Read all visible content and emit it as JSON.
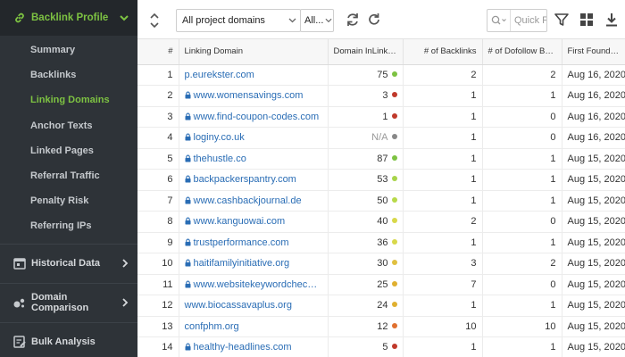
{
  "sidebar": {
    "header": {
      "title": "Backlink Profile",
      "icon": "link-icon",
      "color": "#7dc242"
    },
    "items": [
      {
        "label": "Summary",
        "active": false
      },
      {
        "label": "Backlinks",
        "active": false
      },
      {
        "label": "Linking Domains",
        "active": true
      },
      {
        "label": "Anchor Texts",
        "active": false
      },
      {
        "label": "Linked Pages",
        "active": false
      },
      {
        "label": "Referral Traffic",
        "active": false
      },
      {
        "label": "Penalty Risk",
        "active": false
      },
      {
        "label": "Referring IPs",
        "active": false
      }
    ],
    "sections": [
      {
        "label": "Historical Data",
        "icon": "calendar-icon"
      },
      {
        "label": "Domain Comparison",
        "icon": "bubbles-icon"
      },
      {
        "label": "Bulk Analysis",
        "icon": "list-edit-icon"
      }
    ]
  },
  "toolbar": {
    "domains_select": "All project domains",
    "second_select": "All...",
    "search_placeholder": "Quick F",
    "icons": [
      "sort-icon",
      "refresh-icon",
      "reload-icon",
      "search-icon",
      "filter-icon",
      "grid-icon",
      "download-icon"
    ]
  },
  "table": {
    "columns": [
      "#",
      "Linking Domain",
      "Domain InLink Ra...",
      "# of Backlinks",
      "# of Dofollow Ba...",
      "First Found Date"
    ],
    "rows": [
      {
        "n": "1",
        "domain": "p.eurekster.com",
        "locked": false,
        "rank": "75",
        "dot": "#7dc242",
        "backlinks": "2",
        "dofollow": "2",
        "date": "Aug 16, 2020"
      },
      {
        "n": "2",
        "domain": "www.womensavings.com",
        "locked": true,
        "rank": "3",
        "dot": "#c0392b",
        "backlinks": "1",
        "dofollow": "1",
        "date": "Aug 16, 2020"
      },
      {
        "n": "3",
        "domain": "www.find-coupon-codes.com",
        "locked": true,
        "rank": "1",
        "dot": "#c0392b",
        "backlinks": "1",
        "dofollow": "0",
        "date": "Aug 16, 2020"
      },
      {
        "n": "4",
        "domain": "loginy.co.uk",
        "locked": true,
        "rank": "N/A",
        "dot": "#888888",
        "backlinks": "1",
        "dofollow": "0",
        "date": "Aug 16, 2020"
      },
      {
        "n": "5",
        "domain": "thehustle.co",
        "locked": true,
        "rank": "87",
        "dot": "#7dc242",
        "backlinks": "1",
        "dofollow": "1",
        "date": "Aug 15, 2020"
      },
      {
        "n": "6",
        "domain": "backpackerspantry.com",
        "locked": true,
        "rank": "53",
        "dot": "#a8d44a",
        "backlinks": "1",
        "dofollow": "1",
        "date": "Aug 15, 2020"
      },
      {
        "n": "7",
        "domain": "www.cashbackjournal.de",
        "locked": true,
        "rank": "50",
        "dot": "#b8d94a",
        "backlinks": "1",
        "dofollow": "1",
        "date": "Aug 15, 2020"
      },
      {
        "n": "8",
        "domain": "www.kanguowai.com",
        "locked": true,
        "rank": "40",
        "dot": "#d8d84a",
        "backlinks": "2",
        "dofollow": "0",
        "date": "Aug 15, 2020"
      },
      {
        "n": "9",
        "domain": "trustperformance.com",
        "locked": true,
        "rank": "36",
        "dot": "#d8d84a",
        "backlinks": "1",
        "dofollow": "1",
        "date": "Aug 15, 2020"
      },
      {
        "n": "10",
        "domain": "haitifamilyinitiative.org",
        "locked": true,
        "rank": "30",
        "dot": "#e0c040",
        "backlinks": "3",
        "dofollow": "2",
        "date": "Aug 15, 2020"
      },
      {
        "n": "11",
        "domain": "www.websitekeywordchecker.c...",
        "locked": true,
        "rank": "25",
        "dot": "#e0b030",
        "backlinks": "7",
        "dofollow": "0",
        "date": "Aug 15, 2020"
      },
      {
        "n": "12",
        "domain": "www.biocassavaplus.org",
        "locked": false,
        "rank": "24",
        "dot": "#e0b030",
        "backlinks": "1",
        "dofollow": "1",
        "date": "Aug 15, 2020"
      },
      {
        "n": "13",
        "domain": "confphm.org",
        "locked": false,
        "rank": "12",
        "dot": "#e07030",
        "backlinks": "10",
        "dofollow": "10",
        "date": "Aug 15, 2020"
      },
      {
        "n": "14",
        "domain": "healthy-headlines.com",
        "locked": true,
        "rank": "5",
        "dot": "#c0392b",
        "backlinks": "1",
        "dofollow": "1",
        "date": "Aug 15, 2020"
      }
    ]
  }
}
